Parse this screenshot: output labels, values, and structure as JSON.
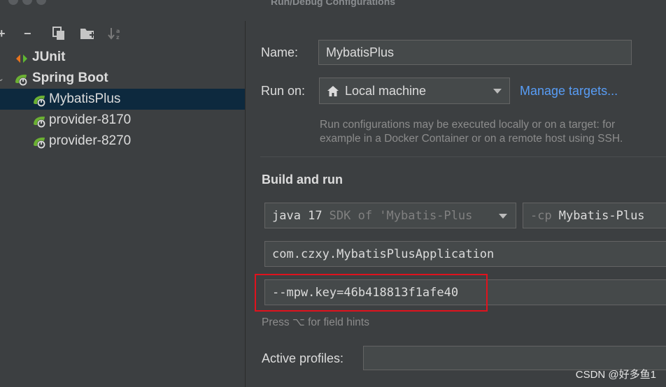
{
  "window": {
    "title": "Run/Debug Configurations"
  },
  "toolbar": {
    "add": "+",
    "remove": "−",
    "copy_icon": "copy-icon",
    "folder_icon": "folder-add-icon",
    "sort_icon": "sort-icon"
  },
  "tree": {
    "junit": "JUnit",
    "spring_boot": "Spring Boot",
    "items": [
      "MybatisPlus",
      "provider-8170",
      "provider-8270"
    ]
  },
  "form": {
    "name_label": "Name:",
    "name_value": "MybatisPlus",
    "run_on_label": "Run on:",
    "run_on_value": "Local machine",
    "manage_targets": "Manage targets...",
    "run_on_hint_1": "Run configurations may be executed locally or on a target: for",
    "run_on_hint_2": "example in a Docker Container or on a remote host using SSH.",
    "build_and_run": "Build and run",
    "jdk_main": "java 17",
    "jdk_sub": "SDK of 'Mybatis-Plus",
    "cp_prefix": "-cp",
    "cp_value": "Mybatis-Plus",
    "main_class": "com.czxy.MybatisPlusApplication",
    "program_args": "--mpw.key=46b418813f1afe40",
    "field_hint": "Press ⌥ for field hints",
    "active_profiles_label": "Active profiles:"
  },
  "watermark": "CSDN @好多鱼1",
  "colors": {
    "highlight": "#e0121d",
    "selection": "#0d293e",
    "link": "#589df6"
  }
}
